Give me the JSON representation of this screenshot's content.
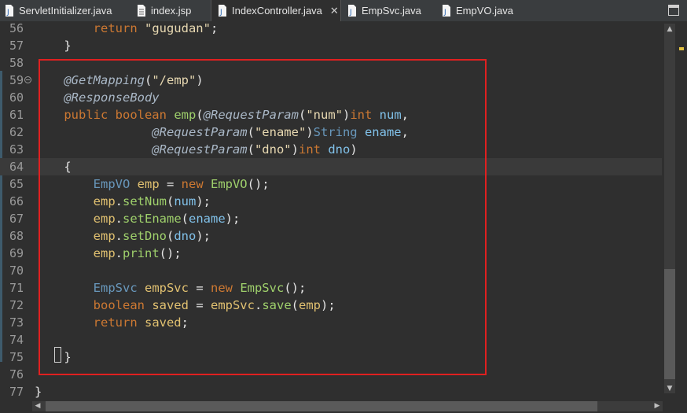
{
  "tabs": [
    {
      "label": "ServletInitializer.java",
      "icon": "java-file-icon",
      "active": false
    },
    {
      "label": "index.jsp",
      "icon": "jsp-file-icon",
      "active": false
    },
    {
      "label": "IndexController.java",
      "icon": "java-file-icon",
      "active": true,
      "close": "✕"
    },
    {
      "label": "EmpSvc.java",
      "icon": "java-file-icon",
      "active": false
    },
    {
      "label": "EmpVO.java",
      "icon": "java-file-icon",
      "active": false
    }
  ],
  "lines": [
    {
      "num": "56",
      "t": [
        [
          "kw",
          "        return "
        ],
        [
          "st",
          "\"gugudan\""
        ],
        [
          "pl",
          ";"
        ]
      ]
    },
    {
      "num": "57",
      "t": [
        [
          "pl",
          "    }"
        ]
      ]
    },
    {
      "num": "58",
      "t": []
    },
    {
      "num": "59",
      "t": [
        [
          "an",
          "    @GetMapping"
        ],
        [
          "pl",
          "("
        ],
        [
          "st",
          "\"/emp\""
        ],
        [
          "pl",
          ")"
        ]
      ]
    },
    {
      "num": "60",
      "t": [
        [
          "an",
          "    @ResponseBody"
        ]
      ]
    },
    {
      "num": "61",
      "t": [
        [
          "kw",
          "    public boolean "
        ],
        [
          "fn",
          "emp"
        ],
        [
          "pl",
          "("
        ],
        [
          "an",
          "@RequestParam"
        ],
        [
          "pl",
          "("
        ],
        [
          "st",
          "\"num\""
        ],
        [
          "pl",
          ")"
        ],
        [
          "kw",
          "int "
        ],
        [
          "cls",
          "num"
        ],
        [
          "pl",
          ","
        ]
      ]
    },
    {
      "num": "62",
      "t": [
        [
          "an",
          "                @RequestParam"
        ],
        [
          "pl",
          "("
        ],
        [
          "st",
          "\"ename\""
        ],
        [
          "pl",
          ")"
        ],
        [
          "ty",
          "String "
        ],
        [
          "cls",
          "ename"
        ],
        [
          "pl",
          ","
        ]
      ]
    },
    {
      "num": "63",
      "t": [
        [
          "an",
          "                @RequestParam"
        ],
        [
          "pl",
          "("
        ],
        [
          "st",
          "\"dno\""
        ],
        [
          "pl",
          ")"
        ],
        [
          "kw",
          "int "
        ],
        [
          "cls",
          "dno"
        ],
        [
          "pl",
          ")"
        ]
      ]
    },
    {
      "num": "64",
      "t": [
        [
          "pl",
          "    {"
        ]
      ]
    },
    {
      "num": "65",
      "t": [
        [
          "ty",
          "        EmpVO "
        ],
        [
          "vr",
          "emp "
        ],
        [
          "pl",
          "= "
        ],
        [
          "kw",
          "new "
        ],
        [
          "fn",
          "EmpVO"
        ],
        [
          "pl",
          "();"
        ]
      ]
    },
    {
      "num": "66",
      "t": [
        [
          "vr",
          "        emp"
        ],
        [
          "pl",
          "."
        ],
        [
          "fn",
          "setNum"
        ],
        [
          "pl",
          "("
        ],
        [
          "cls",
          "num"
        ],
        [
          "pl",
          ");"
        ]
      ]
    },
    {
      "num": "67",
      "t": [
        [
          "vr",
          "        emp"
        ],
        [
          "pl",
          "."
        ],
        [
          "fn",
          "setEname"
        ],
        [
          "pl",
          "("
        ],
        [
          "cls",
          "ename"
        ],
        [
          "pl",
          ");"
        ]
      ]
    },
    {
      "num": "68",
      "t": [
        [
          "vr",
          "        emp"
        ],
        [
          "pl",
          "."
        ],
        [
          "fn",
          "setDno"
        ],
        [
          "pl",
          "("
        ],
        [
          "cls",
          "dno"
        ],
        [
          "pl",
          ");"
        ]
      ]
    },
    {
      "num": "69",
      "t": [
        [
          "vr",
          "        emp"
        ],
        [
          "pl",
          "."
        ],
        [
          "fn",
          "print"
        ],
        [
          "pl",
          "();"
        ]
      ]
    },
    {
      "num": "70",
      "t": []
    },
    {
      "num": "71",
      "t": [
        [
          "ty",
          "        EmpSvc "
        ],
        [
          "vr",
          "empSvc "
        ],
        [
          "pl",
          "= "
        ],
        [
          "kw",
          "new "
        ],
        [
          "fn",
          "EmpSvc"
        ],
        [
          "pl",
          "();"
        ]
      ]
    },
    {
      "num": "72",
      "t": [
        [
          "kw",
          "        boolean "
        ],
        [
          "vr",
          "saved "
        ],
        [
          "pl",
          "= "
        ],
        [
          "vr",
          "empSvc"
        ],
        [
          "pl",
          "."
        ],
        [
          "fn",
          "save"
        ],
        [
          "pl",
          "("
        ],
        [
          "vr",
          "emp"
        ],
        [
          "pl",
          ");"
        ]
      ]
    },
    {
      "num": "73",
      "t": [
        [
          "kw",
          "        return "
        ],
        [
          "vr",
          "saved"
        ],
        [
          "pl",
          ";"
        ]
      ]
    },
    {
      "num": "74",
      "t": []
    },
    {
      "num": "75",
      "t": [
        [
          "pl",
          "    }"
        ]
      ]
    },
    {
      "num": "76",
      "t": []
    },
    {
      "num": "77",
      "t": [
        [
          "pl",
          "}"
        ]
      ]
    }
  ],
  "current_line": "64",
  "fold_line": "59",
  "highlight_color": "#e02020",
  "scroll": {
    "up": "▲",
    "down": "▼",
    "left": "◀",
    "right": "▶"
  }
}
